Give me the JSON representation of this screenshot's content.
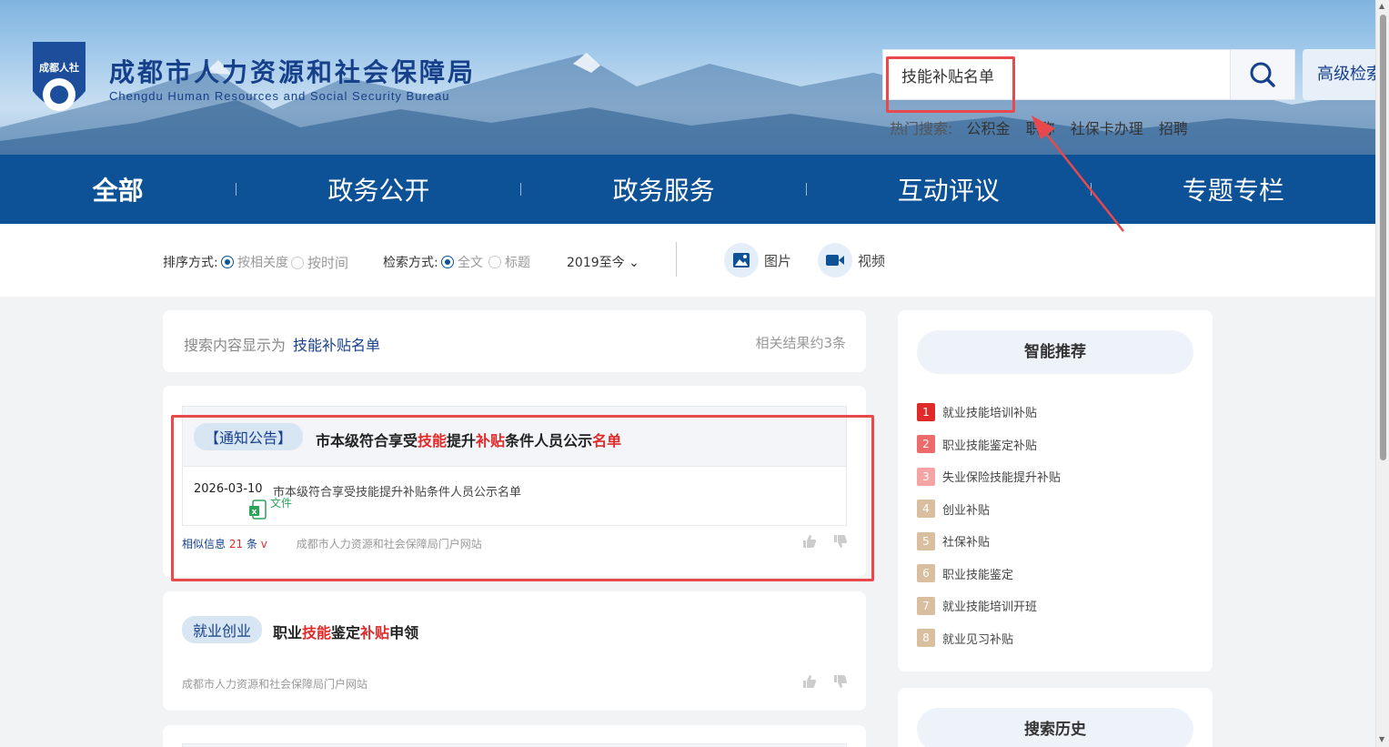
{
  "header": {
    "logo_text": "成都人社",
    "title_cn": "成都市人力资源和社会保障局",
    "title_en": "Chengdu Human Resources and Social Security Bureau",
    "search_value": "技能补贴名单",
    "advanced_search_label": "高级检索",
    "hot_label": "热门搜索:",
    "hot_items": [
      "公积金",
      "职称",
      "社保卡办理",
      "招聘"
    ]
  },
  "nav": {
    "items": [
      "全部",
      "政务公开",
      "政务服务",
      "互动评议",
      "专题专栏"
    ],
    "active_index": 0
  },
  "filters": {
    "sort_label": "排序方式:",
    "sort_options": [
      "按相关度",
      "按时间"
    ],
    "sort_selected": 0,
    "search_mode_label": "检索方式:",
    "search_mode_options": [
      "全文",
      "标题"
    ],
    "search_mode_selected": 0,
    "date_range": "2019至今",
    "image_label": "图片",
    "video_label": "视频"
  },
  "summary": {
    "prefix": "搜索内容显示为",
    "query": "技能补贴名单",
    "count_text": "相关结果约3条"
  },
  "results": [
    {
      "tag": "【通知公告】",
      "title_parts": [
        "市本级符合享受",
        "技能",
        "提升",
        "补贴",
        "条件人员公示",
        "名单"
      ],
      "date": "2026-03-10",
      "desc": "市本级符合享受技能提升补贴条件人员公示名单",
      "file_label": "文件",
      "similar_prefix": "相似信息",
      "similar_count": "21",
      "similar_suffix": "条",
      "source": "成都市人力资源和社会保障局门户网站"
    },
    {
      "tag": "就业创业",
      "title_parts": [
        "职业",
        "技能",
        "鉴定",
        "补贴",
        "申领"
      ],
      "source": "成都市人力资源和社会保障局门户网站"
    }
  ],
  "sidebar": {
    "recommend_title": "智能推荐",
    "recommend_items": [
      {
        "n": "1",
        "label": "就业技能培训补贴",
        "color": "#e02a2a"
      },
      {
        "n": "2",
        "label": "职业技能鉴定补贴",
        "color": "#ee6b6b"
      },
      {
        "n": "3",
        "label": "失业保险技能提升补贴",
        "color": "#f5a3a3"
      },
      {
        "n": "4",
        "label": "创业补贴",
        "color": "#d9bf9f"
      },
      {
        "n": "5",
        "label": "社保补贴",
        "color": "#d9bf9f"
      },
      {
        "n": "6",
        "label": "职业技能鉴定",
        "color": "#d9bf9f"
      },
      {
        "n": "7",
        "label": "就业技能培训开班",
        "color": "#d9bf9f"
      },
      {
        "n": "8",
        "label": "就业见习补贴",
        "color": "#d9bf9f"
      }
    ],
    "history_title": "搜索历史"
  },
  "colors": {
    "primary": "#0d5196",
    "highlight": "#e02a2a",
    "annotation": "#e8494c"
  }
}
